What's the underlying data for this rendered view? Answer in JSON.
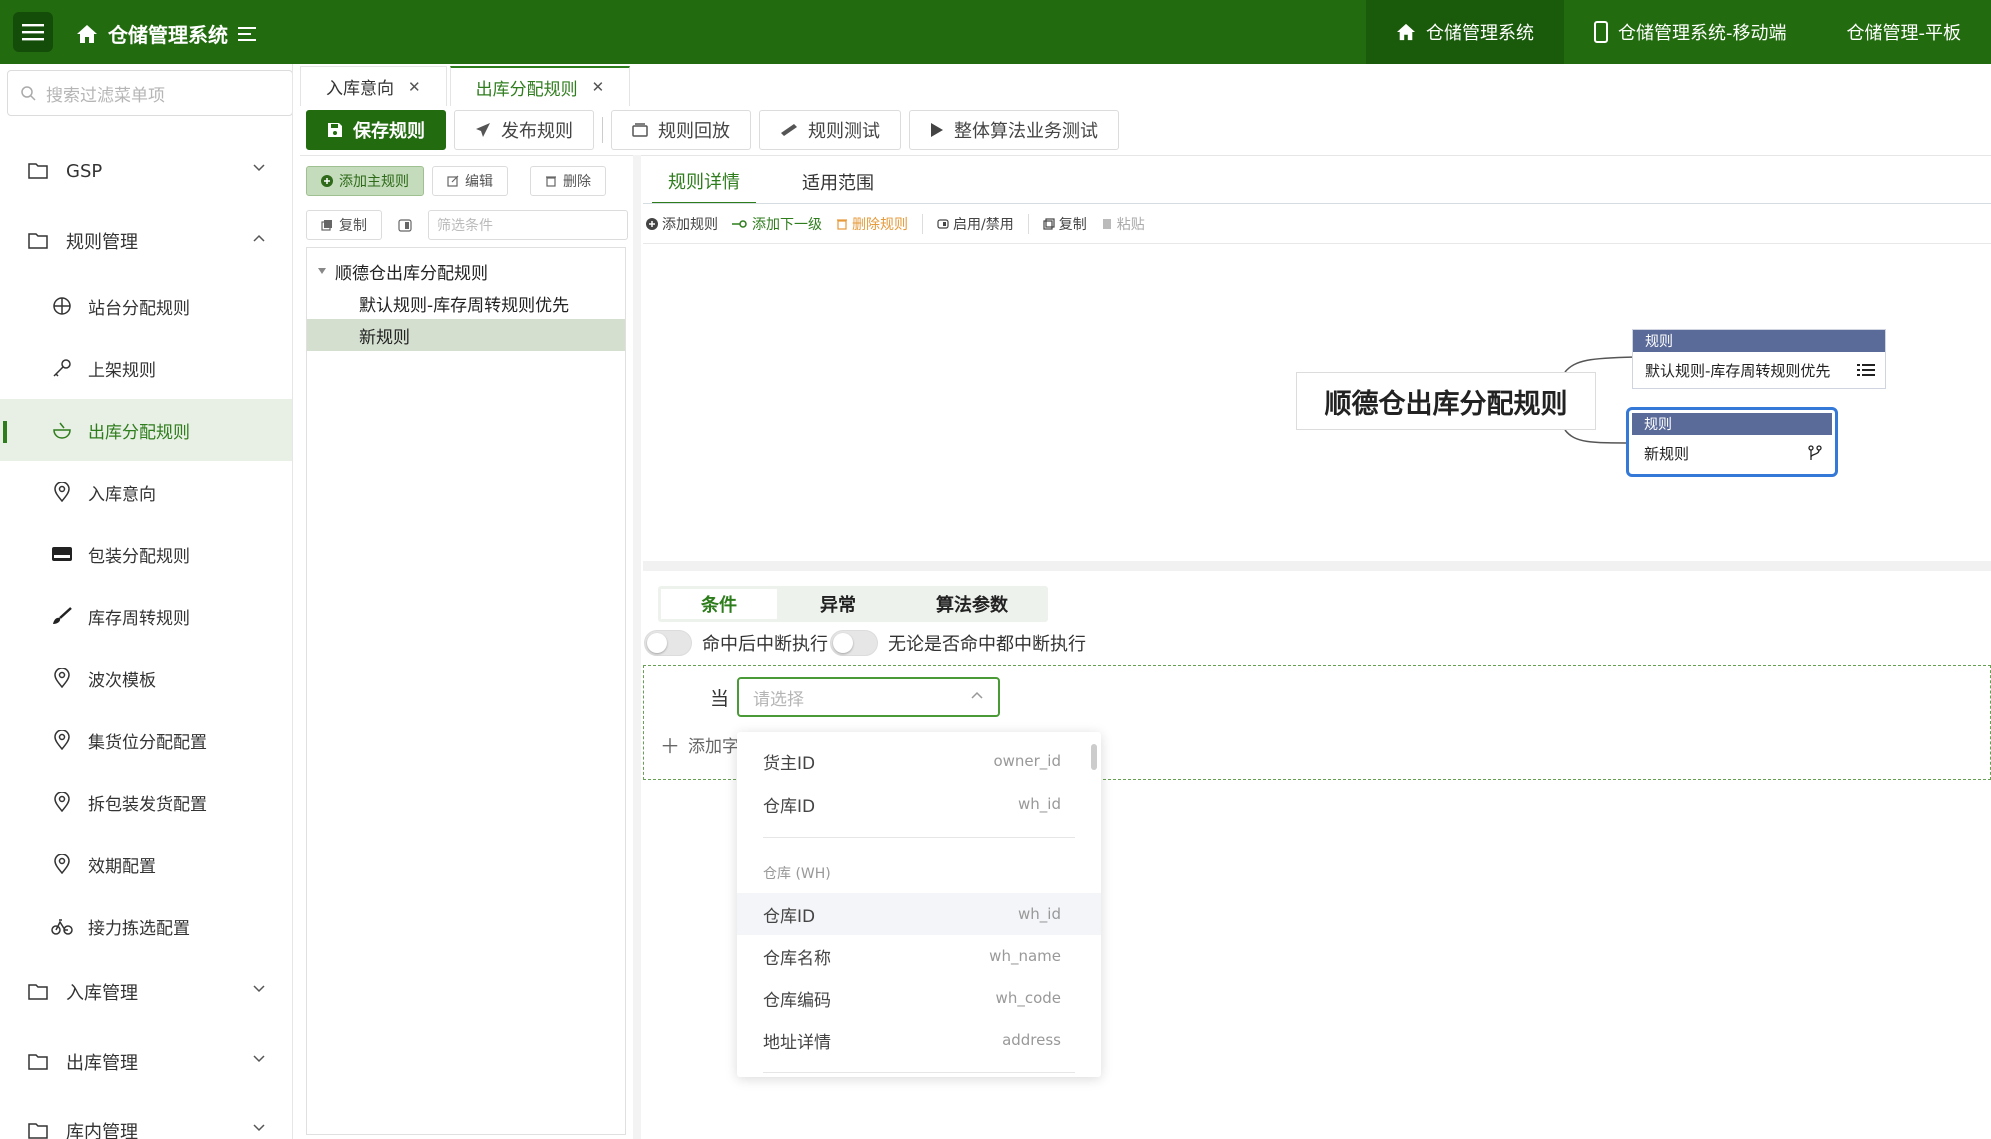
{
  "header": {
    "app_title": "仓储管理系统",
    "links": [
      {
        "label": "仓储管理系统",
        "icon": "home-icon"
      },
      {
        "label": "仓储管理系统-移动端",
        "icon": "mobile-icon"
      },
      {
        "label": "仓储管理-平板",
        "icon": ""
      }
    ],
    "accent_color": "#226b0f"
  },
  "sidebar": {
    "search_placeholder": "搜索过滤菜单项",
    "items": [
      {
        "label": "GSP",
        "level": 1
      },
      {
        "label": "规则管理",
        "level": 1
      },
      {
        "label": "站台分配规则",
        "level": 2
      },
      {
        "label": "上架规则",
        "level": 2
      },
      {
        "label": "出库分配规则",
        "level": 2,
        "active": true
      },
      {
        "label": "入库意向",
        "level": 2
      },
      {
        "label": "包装分配规则",
        "level": 2
      },
      {
        "label": "库存周转规则",
        "level": 2
      },
      {
        "label": "波次模板",
        "level": 2
      },
      {
        "label": "集货位分配配置",
        "level": 2
      },
      {
        "label": "拆包装发货配置",
        "level": 2
      },
      {
        "label": "效期配置",
        "level": 2
      },
      {
        "label": "接力拣选配置",
        "level": 2
      },
      {
        "label": "入库管理",
        "level": 1
      },
      {
        "label": "出库管理",
        "level": 1
      },
      {
        "label": "库内管理",
        "level": 1
      }
    ]
  },
  "tabs": [
    {
      "label": "入库意向",
      "active": false
    },
    {
      "label": "出库分配规则",
      "active": true
    }
  ],
  "toolbar": {
    "save": "保存规则",
    "publish": "发布规则",
    "playback": "规则回放",
    "test": "规则测试",
    "overall_test": "整体算法业务测试"
  },
  "tree_panel": {
    "add_main": "添加主规则",
    "edit": "编辑",
    "delete": "删除",
    "copy": "复制",
    "filter_placeholder": "筛选条件",
    "nodes": [
      {
        "label": "顺德仓出库分配规则",
        "depth": 0
      },
      {
        "label": "默认规则-库存周转规则优先",
        "depth": 1
      },
      {
        "label": "新规则",
        "depth": 1,
        "selected": true
      }
    ]
  },
  "right_tabs": [
    {
      "label": "规则详情",
      "active": true
    },
    {
      "label": "适用范围",
      "active": false
    }
  ],
  "edit_tools": {
    "add_rule": "添加规则",
    "add_child": "添加下一级",
    "delete_rule": "删除规则",
    "toggle": "启用/禁用",
    "copy": "复制",
    "paste": "粘贴"
  },
  "mindmap": {
    "root": "顺德仓出库分配规则",
    "nodes": [
      {
        "header": "规则",
        "label": "默认规则-库存周转规则优先",
        "icon": "list-icon"
      },
      {
        "header": "规则",
        "label": "新规则",
        "icon": "branch-icon",
        "selected": true
      }
    ]
  },
  "condition": {
    "tabs": [
      "条件",
      "异常",
      "算法参数"
    ],
    "switch1_label": "命中后中断执行",
    "switch2_label": "无论是否命中都中断执行",
    "when_label": "当",
    "select_placeholder": "请选择",
    "add_field": "添加字"
  },
  "dropdown": {
    "top_items": [
      {
        "name": "货主ID",
        "code": "owner_id"
      },
      {
        "name": "仓库ID",
        "code": "wh_id"
      }
    ],
    "group_label": "仓库 (WH)",
    "group_items": [
      {
        "name": "仓库ID",
        "code": "wh_id"
      },
      {
        "name": "仓库名称",
        "code": "wh_name"
      },
      {
        "name": "仓库编码",
        "code": "wh_code"
      },
      {
        "name": "地址详情",
        "code": "address"
      }
    ]
  }
}
